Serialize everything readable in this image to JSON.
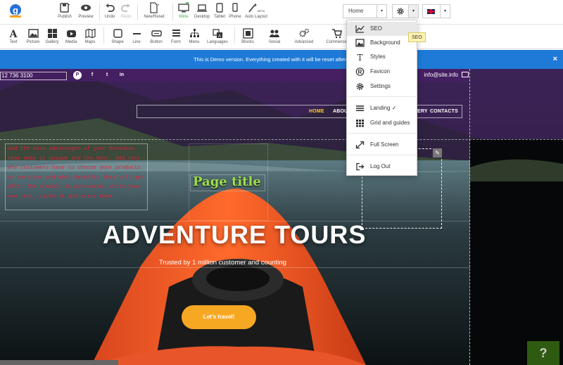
{
  "toolbar": {
    "publish": "Publish",
    "preview": "Preview",
    "undo": "Undo",
    "redo": "Redo",
    "new_reset": "New/Reset",
    "wide": "Wide",
    "desktop": "Desktop",
    "tablet": "Tablet",
    "phone": "Phone",
    "auto_layout": "Auto Layout",
    "beta_badge": "BETA",
    "page_select": "Home"
  },
  "insert": {
    "text": "Text",
    "picture": "Picture",
    "gallery": "Gallery",
    "media": "Media",
    "maps": "Maps",
    "shape": "Shape",
    "line": "Line",
    "button": "Button",
    "form": "Form",
    "menu": "Menu",
    "languages": "Languages",
    "blocks": "Blocks",
    "social": "Social",
    "advanced": "Advanced",
    "commerce": "Commerce"
  },
  "banner": {
    "text": "This is Demo version. Everything created with it will be reset after 24 hours.",
    "close": "×"
  },
  "site": {
    "phone": "12 736 3100",
    "email": "info@site.info",
    "nav": {
      "home": "HOME",
      "about": "ABOUT",
      "gallery": "ERY",
      "contacts": "CONTACTS"
    },
    "text_block": "Add the main advantages of your business that make it unique and the best. Add text why customers have to choose your products or services and what benefits they will get after the product is purchased. Write your own text, style it and press Done.",
    "page_title": "Page title",
    "hero_title": "ADVENTURE TOURS",
    "hero_subtitle": "Trusted by 1 million customer and counting",
    "cta": "Let's travel!",
    "help": "?"
  },
  "menu": {
    "items": [
      {
        "label": "SEO"
      },
      {
        "label": "Background"
      },
      {
        "label": "Styles"
      },
      {
        "label": "Favicon"
      },
      {
        "label": "Settings"
      },
      {
        "label": "Landing ✓"
      },
      {
        "label": "Grid and guides"
      },
      {
        "label": "Full Screen"
      },
      {
        "label": "Log Out"
      }
    ],
    "tooltip": "SEO"
  },
  "colors": {
    "banner": "#1e7ad6",
    "cta": "#f7a823",
    "active_view": "#4caf50",
    "page_title": "#9ee04b",
    "text_block": "#e0203a"
  },
  "icons": [
    "logo-icon",
    "save-icon",
    "eye-icon",
    "undo-icon",
    "redo-icon",
    "file-icon",
    "monitor-icon",
    "laptop-icon",
    "tablet-icon",
    "phone-icon",
    "wand-icon",
    "gear-icon",
    "flag-icon",
    "chart-icon",
    "image-icon",
    "font-icon",
    "registered-icon",
    "grid-icon",
    "expand-icon",
    "logout-icon"
  ]
}
